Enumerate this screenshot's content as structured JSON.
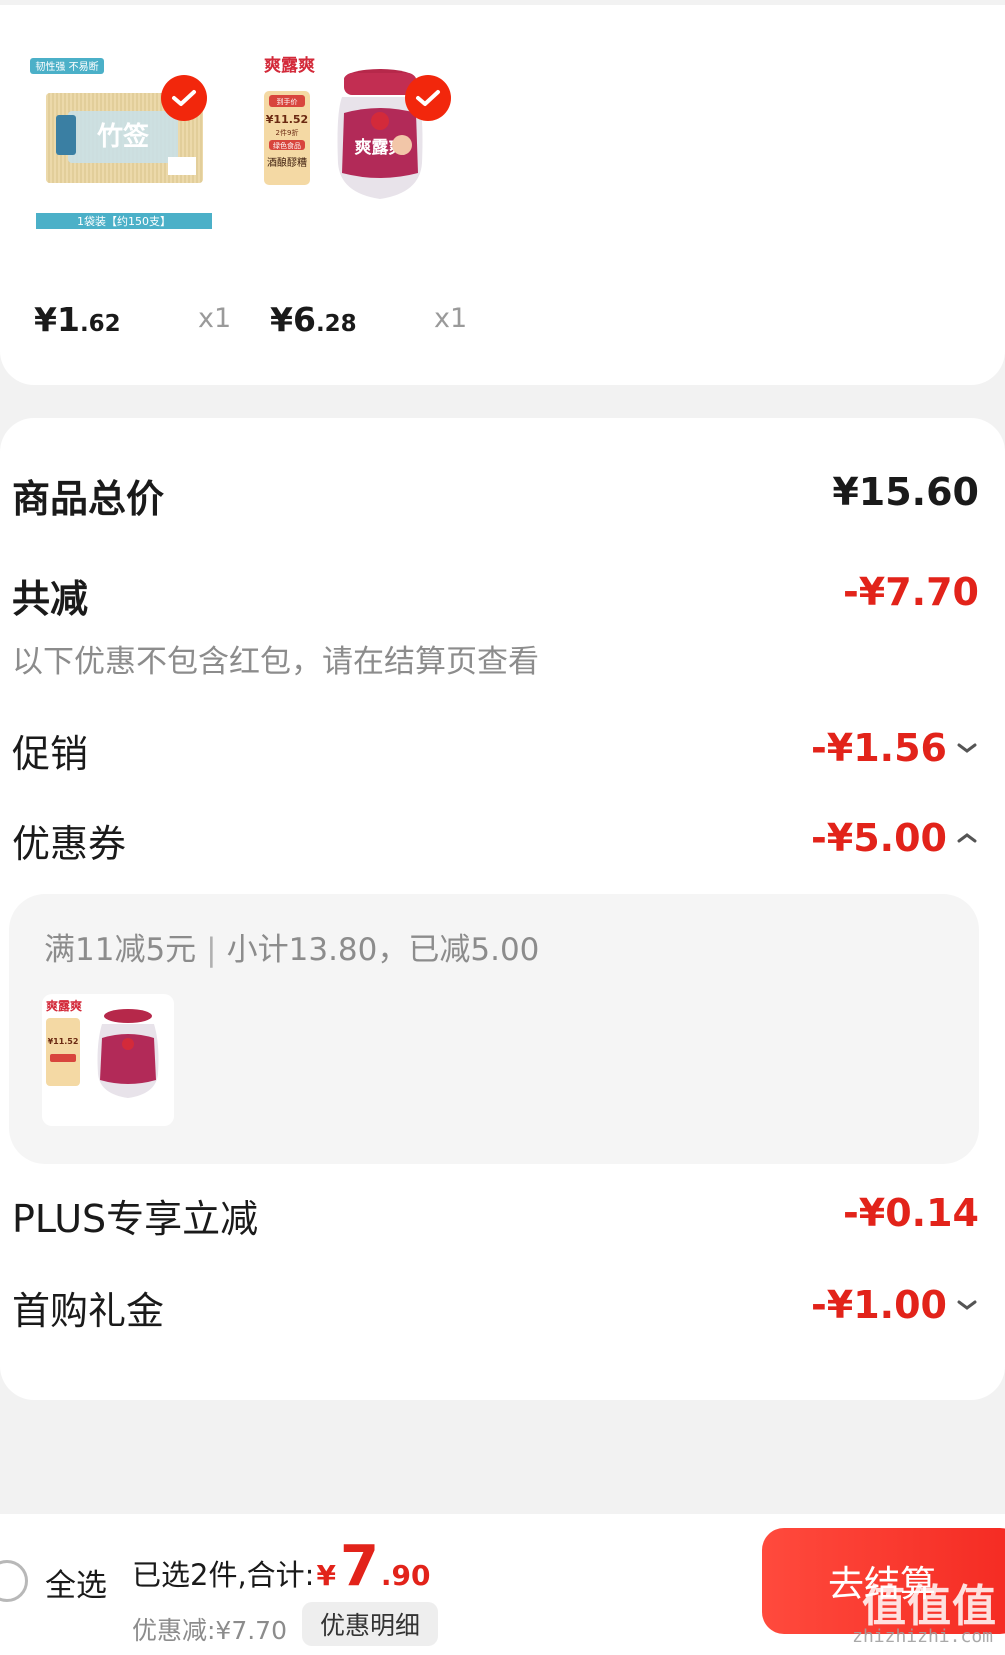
{
  "products": [
    {
      "price_yen": "¥",
      "price_int": "1",
      "price_dec": ".62",
      "qty": "x1",
      "image_text_top": "韧性强 不易断",
      "image_text_bottom": "1袋装【约150支】",
      "image_brand": "竹签"
    },
    {
      "price_yen": "¥",
      "price_int": "6",
      "price_dec": ".28",
      "qty": "x1",
      "image_brand": "爽露爽",
      "image_tag1": "到手价",
      "image_tag2": "¥11.52",
      "image_tag3": "2件9折",
      "image_tag4": "绿色食品",
      "image_tag5": "酒酿醪糟"
    }
  ],
  "summary": {
    "total_label": "商品总价",
    "total_value": "¥15.60",
    "reduce_label": "共减",
    "reduce_value": "-¥7.70",
    "note": "以下优惠不包含红包，请在结算页查看",
    "promo_label": "促销",
    "promo_value": "-¥1.56",
    "coupon_label": "优惠券",
    "coupon_value": "-¥5.00",
    "coupon_rule": "满11减5元",
    "coupon_sep": "|",
    "coupon_detail": "小计13.80，已减5.00",
    "plus_label": "PLUS专享立减",
    "plus_value": "-¥0.14",
    "first_label": "首购礼金",
    "first_value": "-¥1.00"
  },
  "bottom": {
    "select_all": "全选",
    "selected_label": "已选2件,合计:",
    "total_yen": "¥",
    "total_int": "7",
    "total_dec": ".90",
    "discount_text": "优惠减:¥7.70",
    "detail_button": "优惠明细",
    "checkout_button": "去结算",
    "watermark": "值值值",
    "watermark_url": "zhizhizhi.com"
  },
  "colors": {
    "accent": "#f2270c",
    "price_red": "#e2231a",
    "muted": "#8c8c8c"
  }
}
